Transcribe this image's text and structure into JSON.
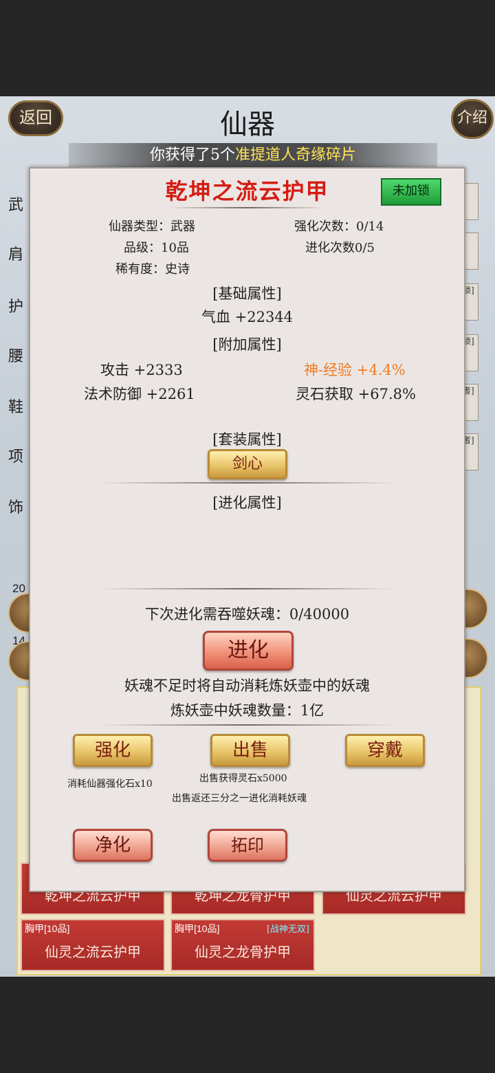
{
  "header": {
    "title": "仙器",
    "back_label": "返回",
    "intro_label": "介绍"
  },
  "banner": {
    "prefix": "你获得了5个",
    "highlight": "准提道人奇缘碎片"
  },
  "side_labels": [
    "武",
    "肩",
    "护",
    "腰",
    "鞋",
    "项",
    "饰"
  ],
  "right_tabs": [
    "锁]",
    "锁]",
    "者]",
    "者]"
  ],
  "modal": {
    "item_name": "乾坤之流云护甲",
    "lock_label": "未加锁",
    "type_label": "仙器类型：武器",
    "enhance_count": "强化次数：0/14",
    "grade": "品级：10品",
    "evolve_count": "进化次数0/5",
    "rarity": "稀有度：史诗",
    "base_header": "[基础属性]",
    "base_attr": "气血 +22344",
    "extra_header": "[附加属性]",
    "extra_attrs": [
      {
        "text": "攻击 +2333",
        "highlight": false
      },
      {
        "text": "神-经验 +4.4%",
        "highlight": true
      },
      {
        "text": "法术防御 +2261",
        "highlight": false
      },
      {
        "text": "灵石获取 +67.8%",
        "highlight": false
      }
    ],
    "set_header": "[套装属性]",
    "set_name": "剑心",
    "evolve_header": "[进化属性]",
    "next_evolve": "下次进化需吞噬妖魂：0/40000",
    "evolve_button": "进化",
    "soul_note": "妖魂不足时将自动消耗炼妖壶中的妖魂",
    "soul_count": "炼妖壶中妖魂数量：1亿",
    "enhance_button": "强化",
    "sell_button": "出售",
    "equip_button": "穿戴",
    "enhance_cost": "消耗仙器强化石x10",
    "sell_gain": "出售获得灵石x5000",
    "sell_return": "出售返还三分之一进化消耗妖魂",
    "purify_button": "净化",
    "rubbing_button": "拓印"
  },
  "list": {
    "cards": [
      {
        "tag": "",
        "name": "乾坤之流云护甲",
        "bonus": ""
      },
      {
        "tag": "",
        "name": "乾坤之龙骨护甲",
        "bonus": ""
      },
      {
        "tag": "",
        "name": "仙灵之流云护甲",
        "bonus": ""
      },
      {
        "tag": "胸甲[10品]",
        "name": "仙灵之流云护甲",
        "bonus": ""
      },
      {
        "tag": "胸甲[10品]",
        "name": "仙灵之龙骨护甲",
        "bonus": "[战神无双]"
      }
    ]
  },
  "left_numbers": [
    "20",
    "14"
  ],
  "colors": {
    "title_red": "#d51c12",
    "highlight_orange": "#ef7a24",
    "banner_yellow": "#ffe25a",
    "lock_green": "#2fbf50"
  }
}
